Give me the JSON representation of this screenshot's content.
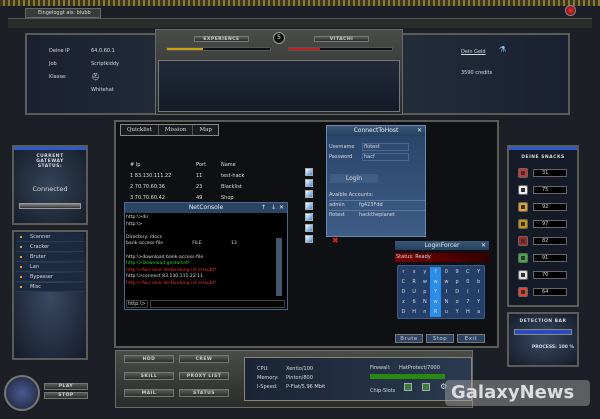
{
  "top": {
    "login_tab": "Eingeloggt als: blubb"
  },
  "info": {
    "ip_label": "Deine IP",
    "ip": "64.0.60.1",
    "job_label": "Job",
    "job": "Scriptkiddy",
    "class_label": "Klasse:",
    "class": "Whitehat",
    "money_link": "Dein Geld",
    "credits": "3590 credits",
    "experience_label": "EXPERIENCE",
    "vitachi_label": "VITACHI",
    "level": "5",
    "experience_progress": 0.35,
    "vitachi_progress": 0.3
  },
  "gateway": {
    "title": "CURRENT GATEWAY STATUS:",
    "status": "Connected"
  },
  "menu": [
    "Scanner",
    "Cracker",
    "Bruter",
    "Lan",
    "Bypasser",
    "Misc"
  ],
  "player": {
    "play": "PLAY",
    "stop": "STOP"
  },
  "tabs": [
    "Quicklist",
    "Mission",
    "Map"
  ],
  "hosts": {
    "headers": [
      "# Ip",
      "Port",
      "Name"
    ],
    "rows": [
      {
        "n": "1",
        "ip": "83.130.111.22",
        "port": "11",
        "name": "test-hack"
      },
      {
        "n": "2",
        "ip": "70.70.60.36",
        "port": "23",
        "name": "Blacklist"
      },
      {
        "n": "3",
        "ip": "70.70.60.42",
        "port": "49",
        "name": "Shop"
      }
    ]
  },
  "connect": {
    "title": "ConnectToHost",
    "user_label": "Username",
    "user": "flotest",
    "pass_label": "Password",
    "pass": "hacf",
    "login": "Login",
    "accounts_label": "Avaible Accounts:",
    "accounts": [
      [
        "admin",
        "fg423Fdd"
      ],
      [
        "flotest",
        "hacktheplanet"
      ]
    ]
  },
  "console": {
    "title": "NetConsole",
    "lines": [
      {
        "t": "http:\\>dir",
        "c": "#ddd"
      },
      {
        "t": "http:\\>",
        "c": "#ddd"
      },
      {
        "t": "",
        "c": "#ddd"
      },
      {
        "t": "Directory: /docs",
        "c": "#ddd"
      },
      {
        "t": "bank-access-file                    FILE                    13",
        "c": "#ddd"
      },
      {
        "t": "",
        "c": "#ddd"
      },
      {
        "t": "http:\\>download bank-access-file",
        "c": "#ddd"
      },
      {
        "t": "http:\\>Download gestartet!",
        "c": "#3c3"
      },
      {
        "t": "http:\\>Nur eine Verbindung ist erlaubt!",
        "c": "#e33"
      },
      {
        "t": "http:\\>connect 83.130.111.22:11",
        "c": "#ddd"
      },
      {
        "t": "http:\\>Nur eine Verbindung ist erlaubt!",
        "c": "#e33"
      }
    ],
    "prompt": "http:\\>"
  },
  "forcer": {
    "title": "LoginForcer",
    "status": "Status: Ready",
    "grid": [
      [
        "r",
        "x",
        "y",
        "f",
        "0",
        "9",
        "C",
        "Y"
      ],
      [
        "C",
        "R",
        "w",
        "w",
        "w",
        "p",
        "0",
        "b"
      ],
      [
        "D",
        "U",
        "p",
        "Y",
        "I",
        "D",
        "I",
        "i"
      ],
      [
        "z",
        "6",
        "N",
        "w",
        "N",
        "o",
        "7",
        "Y"
      ],
      [
        "D",
        "H",
        "n",
        "R",
        "u",
        "Y",
        "H",
        "a"
      ]
    ],
    "brute": "Brute",
    "stop": "Stop",
    "exit": "Exit"
  },
  "snacks": {
    "title": "DEINE SNACKS",
    "values": [
      "31",
      "75",
      "92",
      "97",
      "82",
      "91",
      "70",
      "64"
    ],
    "icons": [
      "meat",
      "cake",
      "beer",
      "burger",
      "apple",
      "salad",
      "milk",
      "sausage"
    ]
  },
  "detection": {
    "title": "DETECTION BAR",
    "progress_label": "PROCESS: 100 %",
    "progress": 1.0
  },
  "bottom": {
    "buttons": [
      "HDD",
      "CREW",
      "SKILL",
      "PROXY LIST",
      "MAIL",
      "STATUS"
    ],
    "cpu_label": "CPU:",
    "cpu": "Xentio/100",
    "mem_label": "Memory:",
    "mem": "Pinton/800",
    "speed_label": "I-Speed:",
    "speed": "P-Flat/5.96 Mbit",
    "fw_label": "Firewall:",
    "fw": "HatProtect/7000",
    "chip_label": "Chip-Slots"
  },
  "watermark": "GalaxyNews"
}
